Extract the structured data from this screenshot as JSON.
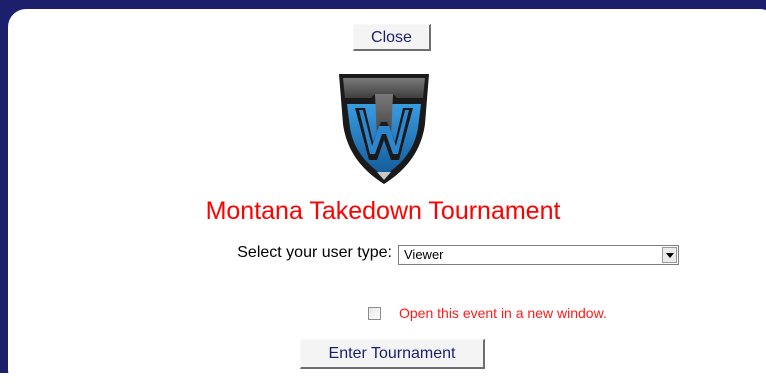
{
  "dialog": {
    "close_label": "Close",
    "logo_icon": "takedown-shield-logo",
    "title": "Montana Takedown Tournament",
    "user_type": {
      "label": "Select your user type:",
      "selected": "Viewer"
    },
    "new_window": {
      "label": "Open this event in a new window.",
      "checked": false
    },
    "enter_label": "Enter Tournament"
  },
  "colors": {
    "frame": "#1c1f6b",
    "title": "#ff0000",
    "button_text": "#1a1f6e",
    "logo_blue": "#1e6fb8",
    "logo_grey": "#5a5a5a"
  }
}
